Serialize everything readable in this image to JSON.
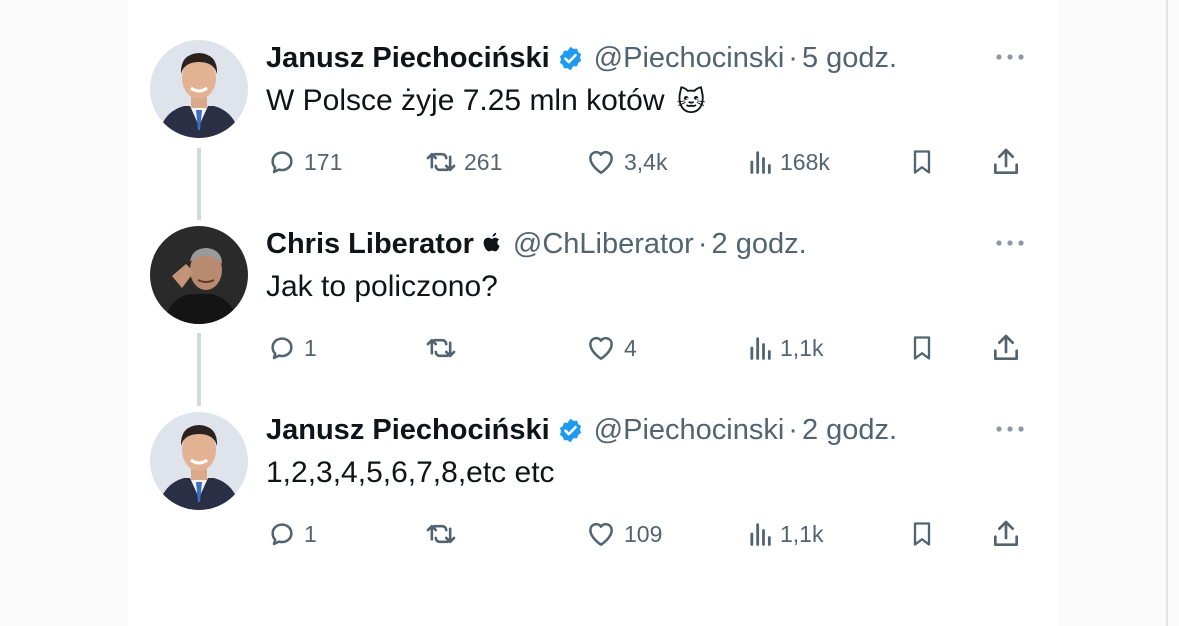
{
  "tweets": [
    {
      "name": "Janusz Piechociński",
      "handle": "@Piechocinski",
      "separator": "·",
      "time": "5 godz.",
      "text": "W Polsce żyje 7.25 mln kotów",
      "emoji": "🐱",
      "badge": "verified-badge-icon",
      "stats": {
        "replies": "171",
        "retweets": "261",
        "likes": "3,4k",
        "views": "168k"
      }
    },
    {
      "name": "Chris Liberator",
      "handle": "@ChLiberator",
      "separator": "·",
      "time": "2 godz.",
      "text": "Jak to policzono?",
      "badge": "apple-icon",
      "stats": {
        "replies": "1",
        "retweets": "",
        "likes": "4",
        "views": "1,1k"
      }
    },
    {
      "name": "Janusz Piechociński",
      "handle": "@Piechocinski",
      "separator": "·",
      "time": "2 godz.",
      "text": "1,2,3,4,5,6,7,8,etc etc",
      "badge": "verified-badge-icon",
      "stats": {
        "replies": "1",
        "retweets": "",
        "likes": "109",
        "views": "1,1k"
      }
    }
  ],
  "colors": {
    "verified": "#1d9bf0",
    "muted": "#536471",
    "text": "#0f1419",
    "thread": "#cfd9de"
  }
}
